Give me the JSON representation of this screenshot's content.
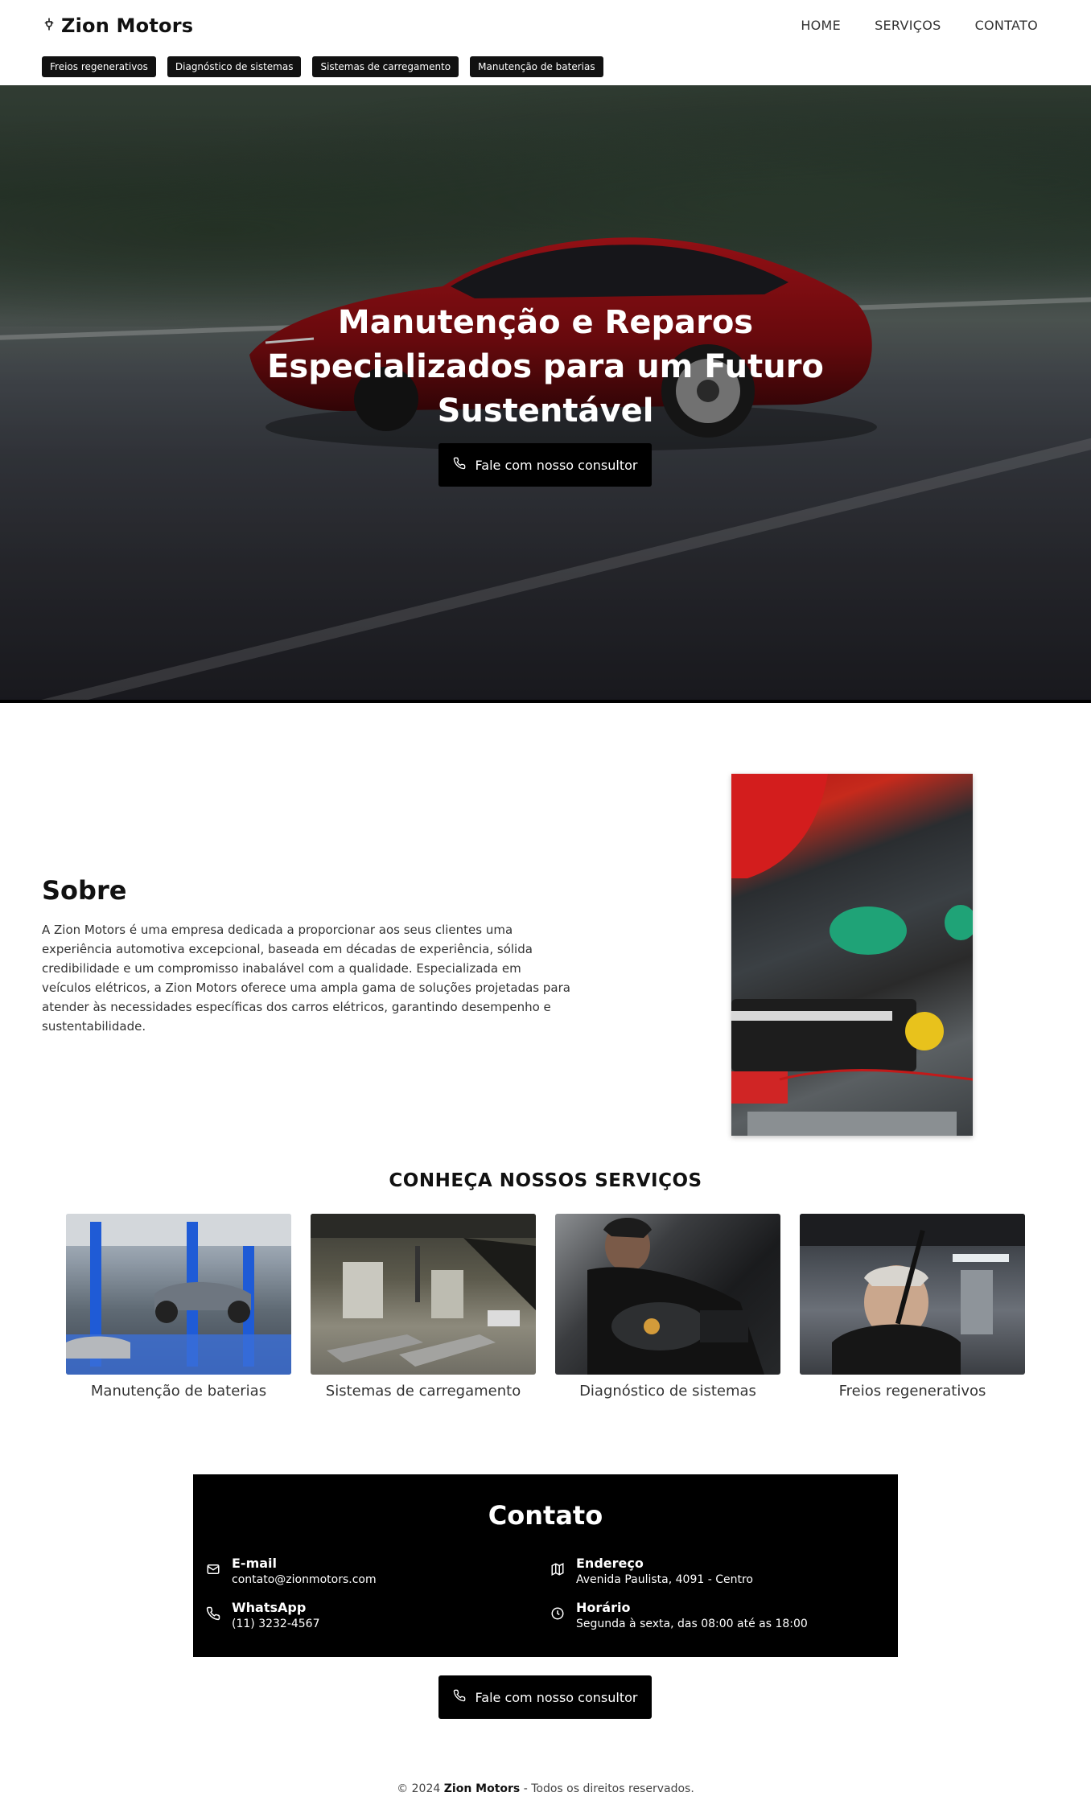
{
  "brand": {
    "name": "Zion Motors"
  },
  "nav": {
    "items": [
      "HOME",
      "SERVIÇOS",
      "CONTATO"
    ]
  },
  "tags": [
    "Freios regenerativos",
    "Diagnóstico de sistemas",
    "Sistemas de carregamento",
    "Manutenção de baterias"
  ],
  "hero": {
    "title_lines": [
      "Manutenção e Reparos",
      "Especializados para um Futuro",
      "Sustentável"
    ],
    "cta_label": "Fale com nosso consultor"
  },
  "about": {
    "title": "Sobre",
    "text": "A Zion Motors é uma empresa dedicada a proporcionar aos seus clientes uma experiência automotiva excepcional, baseada em décadas de experiência, sólida credibilidade e um compromisso inabalável com a qualidade. Especializada em veículos elétricos, a Zion Motors oferece uma ampla gama de soluções projetadas para atender às necessidades específicas dos carros elétricos, garantindo desempenho e sustentabilidade."
  },
  "services": {
    "title": "CONHEÇA NOSSOS SERVIÇOS",
    "items": [
      {
        "label": "Manutenção de baterias"
      },
      {
        "label": "Sistemas de carregamento"
      },
      {
        "label": "Diagnóstico de sistemas"
      },
      {
        "label": "Freios regenerativos"
      }
    ]
  },
  "contact": {
    "title": "Contato",
    "email": {
      "label": "E-mail",
      "value": "contato@zionmotors.com"
    },
    "whatsapp": {
      "label": "WhatsApp",
      "value": "(11) 3232-4567"
    },
    "address": {
      "label": "Endereço",
      "value": "Avenida Paulista, 4091 - Centro"
    },
    "hours": {
      "label": "Horário",
      "value": "Segunda à sexta, das 08:00 até as 18:00"
    },
    "cta_label": "Fale com nosso consultor"
  },
  "footer": {
    "prefix": "© 2024",
    "brand": "Zion Motors",
    "suffix": "- Todos os direitos reservados."
  },
  "icons": {
    "logo": "plug-icon",
    "phone": "phone-icon",
    "email": "mail-icon",
    "address": "map-icon",
    "hours": "clock-icon"
  },
  "colors": {
    "primary": "#000000",
    "background": "#ffffff",
    "text": "#222222"
  }
}
